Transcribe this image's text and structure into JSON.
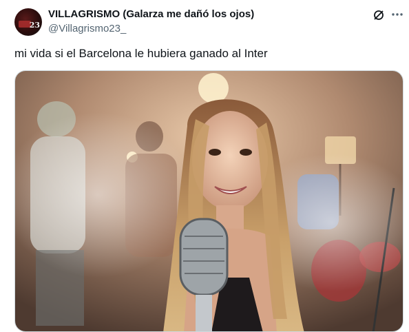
{
  "author": {
    "display_name": "VILLAGRISMO (Galarza me dañó los ojos)",
    "handle": "@Villagrismo23_",
    "avatar_text": "23"
  },
  "post": {
    "text": "mi vida si el Barcelona le hubiera ganado al Inter"
  },
  "media": {
    "description": "video still: smiling young woman with long hair singing at a vintage microphone, band in smoky room"
  },
  "icons": [
    "grok-icon",
    "more-options-icon"
  ]
}
